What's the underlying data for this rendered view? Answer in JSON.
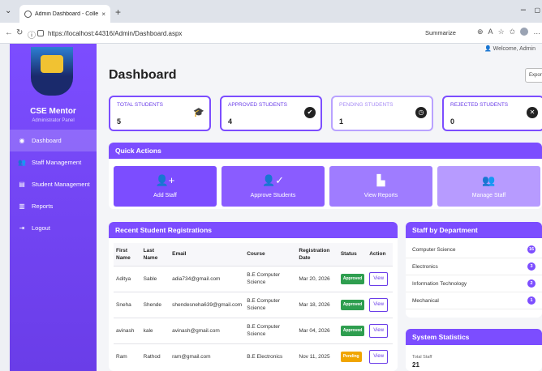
{
  "browser": {
    "tab_title": "Admin Dashboard - CollegePro",
    "tab_close": "×",
    "new_tab": "+",
    "url": "https://localhost:44316/Admin/Dashboard.aspx",
    "summarize": "Summarize",
    "min": "–",
    "max": "▢"
  },
  "sidebar": {
    "brand": "CSE Mentor",
    "sub": "Administrator Panel",
    "items": [
      {
        "label": "Dashboard",
        "icon": "◉"
      },
      {
        "label": "Staff Management",
        "icon": "👥"
      },
      {
        "label": "Student Management",
        "icon": "▤"
      },
      {
        "label": "Reports",
        "icon": "▥"
      },
      {
        "label": "Logout",
        "icon": "⇥"
      }
    ]
  },
  "header": {
    "welcome": "Welcome, Admin",
    "title": "Dashboard",
    "export": "Export"
  },
  "stats": [
    {
      "label": "TOTAL STUDENTS",
      "value": "5",
      "icon": "🎓"
    },
    {
      "label": "APPROVED STUDENTS",
      "value": "4",
      "icon": "✔"
    },
    {
      "label": "PENDING STUDENTS",
      "value": "1",
      "icon": "◷"
    },
    {
      "label": "REJECTED STUDENTS",
      "value": "0",
      "icon": "✕"
    }
  ],
  "quick_actions": {
    "title": "Quick Actions",
    "items": [
      {
        "label": "Add Staff",
        "icon": "👤+",
        "color": "#7c4dff"
      },
      {
        "label": "Approve Students",
        "icon": "👤✓",
        "color": "#8a5cff"
      },
      {
        "label": "View Reports",
        "icon": "▙",
        "color": "#9f7cff"
      },
      {
        "label": "Manage Staff",
        "icon": "👥",
        "color": "#b79bff"
      }
    ]
  },
  "recent": {
    "title": "Recent Student Registrations",
    "columns": [
      "First Name",
      "Last Name",
      "Email",
      "Course",
      "Registration Date",
      "Status",
      "Action"
    ],
    "rows": [
      {
        "first": "Aditya",
        "last": "Sable",
        "email": "adia734@gmail.com",
        "course": "B.E Computer Science",
        "date": "Mar 20, 2026",
        "status": "Approved",
        "action": "View"
      },
      {
        "first": "Sneha",
        "last": "Shende",
        "email": "shendesneha639@gmail.com",
        "course": "B.E Computer Science",
        "date": "Mar 18, 2026",
        "status": "Approved",
        "action": "View"
      },
      {
        "first": "avinash",
        "last": "kale",
        "email": "avinash@gmail.com",
        "course": "B.E Computer Science",
        "date": "Mar 04, 2026",
        "status": "Approved",
        "action": "View"
      },
      {
        "first": "Ram",
        "last": "Rathod",
        "email": "ram@gmail.com",
        "course": "B.E Electronics",
        "date": "Nov 11, 2025",
        "status": "Pending",
        "action": "View"
      }
    ]
  },
  "dept": {
    "title": "Staff by Department",
    "items": [
      {
        "name": "Computer Science",
        "count": "16"
      },
      {
        "name": "Electronics",
        "count": "3"
      },
      {
        "name": "Information Technology",
        "count": "2"
      },
      {
        "name": "Mechanical",
        "count": "1"
      }
    ]
  },
  "system": {
    "title": "System Statistics",
    "label": "Total Staff",
    "value": "21"
  },
  "colors": {
    "accent": "#7c4dff",
    "approved": "#2e9e4f",
    "pending": "#f0a500"
  }
}
